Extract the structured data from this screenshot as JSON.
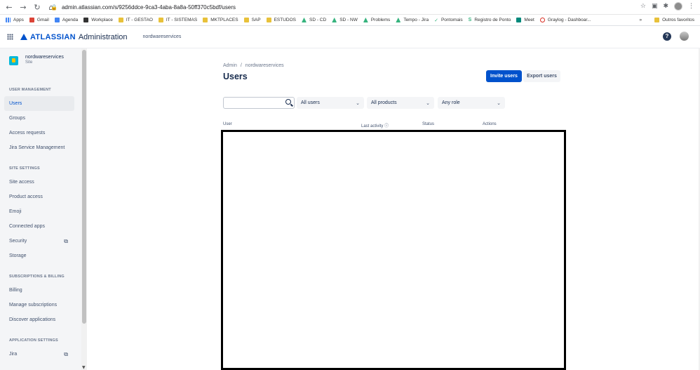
{
  "browser": {
    "url": "admin.atlassian.com/s/9256ddce-9ca3-4aba-8a8a-50ff370c5bdf/users",
    "bookmarks": [
      {
        "label": "Apps",
        "icon": "grid"
      },
      {
        "label": "Gmail",
        "icon": "gmail"
      },
      {
        "label": "Agenda",
        "icon": "calendar"
      },
      {
        "label": "Workplace",
        "icon": "workplace"
      },
      {
        "label": "IT - GESTAO",
        "icon": "folder"
      },
      {
        "label": "IT - SISTEMAS",
        "icon": "folder"
      },
      {
        "label": "MKTPLACES",
        "icon": "folder"
      },
      {
        "label": "SAP",
        "icon": "folder"
      },
      {
        "label": "ESTUDOS",
        "icon": "folder"
      },
      {
        "label": "SD - CD",
        "icon": "atlassian"
      },
      {
        "label": "SD - NW",
        "icon": "atlassian"
      },
      {
        "label": "Problems",
        "icon": "atlassian"
      },
      {
        "label": "Tempo - Jira",
        "icon": "atlassian"
      },
      {
        "label": "Pontomais",
        "icon": "check"
      },
      {
        "label": "Registro de Ponto",
        "icon": "s"
      },
      {
        "label": "Meet",
        "icon": "meet"
      },
      {
        "label": "Graylog - Dashboar...",
        "icon": "graylog"
      }
    ],
    "more": "»",
    "other_favorites": "Outros favoritos"
  },
  "header": {
    "logo": "ATLASSIAN",
    "product": "Administration",
    "site": "nordwareservices"
  },
  "sidebar": {
    "org": {
      "name": "nordwareservices",
      "type": "Site"
    },
    "sections": [
      {
        "title": "USER MANAGEMENT",
        "items": [
          {
            "label": "Users",
            "active": true
          },
          {
            "label": "Groups"
          },
          {
            "label": "Access requests"
          },
          {
            "label": "Jira Service Management"
          }
        ]
      },
      {
        "title": "SITE SETTINGS",
        "items": [
          {
            "label": "Site access"
          },
          {
            "label": "Product access"
          },
          {
            "label": "Emoji"
          },
          {
            "label": "Connected apps"
          },
          {
            "label": "Security",
            "external": true
          },
          {
            "label": "Storage"
          }
        ]
      },
      {
        "title": "SUBSCRIPTIONS & BILLING",
        "items": [
          {
            "label": "Billing"
          },
          {
            "label": "Manage subscriptions"
          },
          {
            "label": "Discover applications"
          }
        ]
      },
      {
        "title": "APPLICATION SETTINGS",
        "items": [
          {
            "label": "Jira",
            "external": true
          }
        ]
      }
    ]
  },
  "main": {
    "breadcrumb": [
      "Admin",
      "nordwareservices"
    ],
    "breadcrumb_sep": "/",
    "title": "Users",
    "invite_label": "Invite users",
    "export_label": "Export users",
    "search_placeholder": "",
    "filters": {
      "users": "All users",
      "products": "All products",
      "role": "Any role"
    },
    "columns": {
      "user": "User",
      "last_activity": "Last activity ⓘ",
      "status": "Status",
      "actions": "Actions"
    }
  }
}
